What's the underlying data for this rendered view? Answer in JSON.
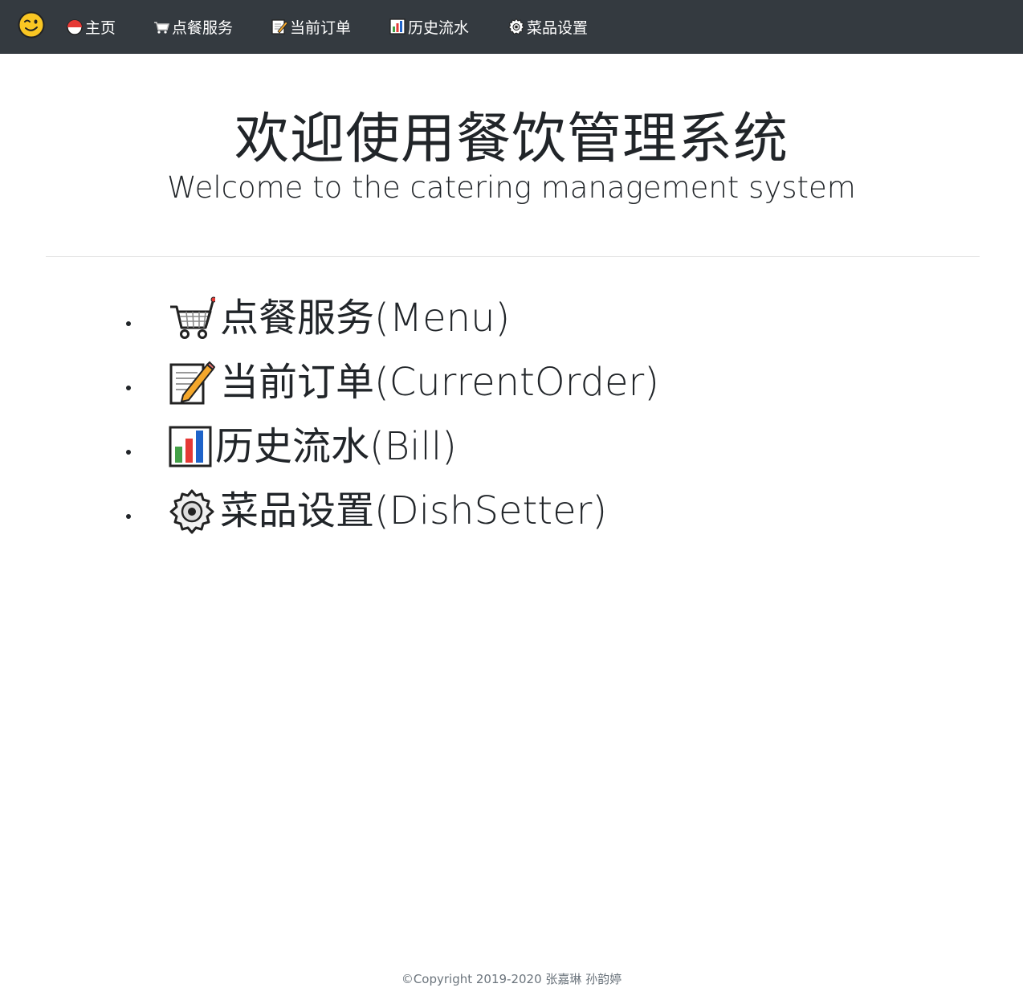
{
  "navbar": {
    "brand_icon": "winking-face-icon",
    "items": [
      {
        "label": "主页",
        "icon": "home-icon"
      },
      {
        "label": "点餐服务",
        "icon": "shopping-cart-icon"
      },
      {
        "label": "当前订单",
        "icon": "memo-icon"
      },
      {
        "label": "历史流水",
        "icon": "bar-chart-icon"
      },
      {
        "label": "菜品设置",
        "icon": "gear-icon"
      }
    ]
  },
  "hero": {
    "title": "欢迎使用餐饮管理系统",
    "subtitle": "Welcome to the catering management system"
  },
  "features": [
    {
      "label": "点餐服务(Menu)",
      "icon": "shopping-cart-icon"
    },
    {
      "label": "当前订单(CurrentOrder)",
      "icon": "memo-icon"
    },
    {
      "label": "历史流水(Bill)",
      "icon": "bar-chart-icon"
    },
    {
      "label": "菜品设置(DishSetter)",
      "icon": "gear-icon"
    }
  ],
  "footer": {
    "copyright": "©Copyright 2019-2020 张嘉琳 孙韵婷"
  },
  "colors": {
    "navbar_bg": "#343a40",
    "nav_text": "#ffffff",
    "body_text": "#212529",
    "footer_text": "#6c757d"
  }
}
